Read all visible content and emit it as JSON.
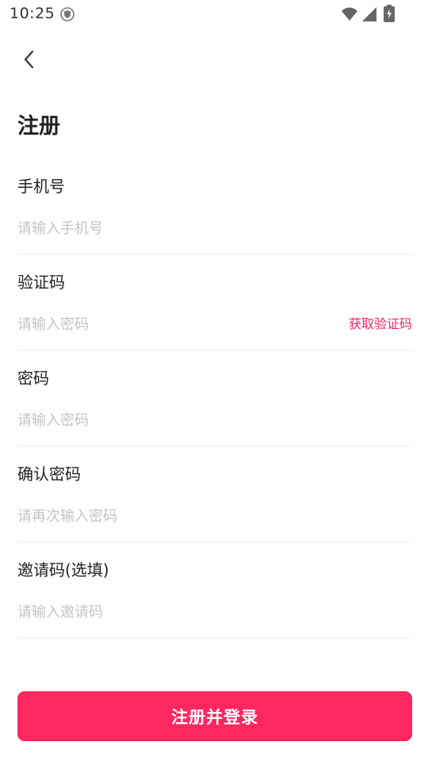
{
  "status_bar": {
    "time": "10:25",
    "icons": [
      "shield-icon",
      "wifi-icon",
      "signal-icon",
      "battery-charging-icon"
    ]
  },
  "header": {
    "back_icon": "chevron-left-icon",
    "title": "注册"
  },
  "form": {
    "phone": {
      "label": "手机号",
      "placeholder": "请输入手机号"
    },
    "verification_code": {
      "label": "验证码",
      "placeholder": "请输入密码",
      "action_label": "获取验证码"
    },
    "password": {
      "label": "密码",
      "placeholder": "请输入密码"
    },
    "confirm_password": {
      "label": "确认密码",
      "placeholder": "请再次输入密码"
    },
    "invite_code": {
      "label": "邀请码(选填)",
      "placeholder": "请输入邀请码"
    }
  },
  "submit_label": "注册并登录",
  "colors": {
    "accent": "#fe2760",
    "accent_text": "#f5275d",
    "placeholder": "#c4c4c4",
    "divider": "#efefef"
  }
}
